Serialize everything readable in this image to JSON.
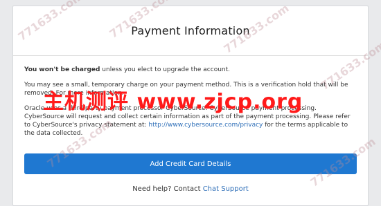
{
  "dialog": {
    "title": "Payment Information",
    "charge_notice_bold": "You won't be charged",
    "charge_notice_rest": " unless you elect to upgrade the account.",
    "verification_text": "You may see a small, temporary charge on your payment method. This is a verification hold that will be removed. For more information.",
    "processor_text_before": "Oracle uses a third party payment processor CyberSource. CyberSource payment processing. CyberSource will request and collect certain information as part of the payment processing. Please refer to CyberSource's privacy statement at: ",
    "processor_link": "http://www.cybersource.com/privacy",
    "processor_text_after": " for the terms applicable to the data collected.",
    "primary_button": "Add Credit Card Details",
    "help_text": "Need help? Contact ",
    "help_link": "Chat Support"
  },
  "watermark": {
    "main": "主机测评 www.zjcp.org",
    "tiles": [
      "771633.com",
      "771633.com",
      "771633.com",
      "771633.com",
      "771633.com",
      "771633.com"
    ]
  },
  "colors": {
    "primary": "#1f78d1",
    "link": "#2f6fb8",
    "watermark_main": "#ff1a1a"
  }
}
